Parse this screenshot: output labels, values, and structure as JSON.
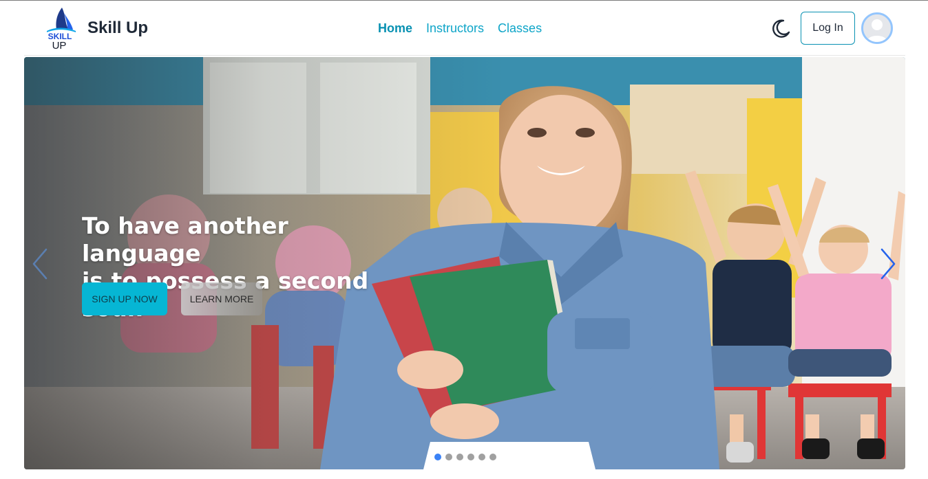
{
  "brand": {
    "logo_text_top": "SKILL",
    "logo_text_bottom": "UP",
    "name": "Skill Up"
  },
  "nav": {
    "links": [
      {
        "label": "Home",
        "active": true
      },
      {
        "label": "Instructors",
        "active": false
      },
      {
        "label": "Classes",
        "active": false
      }
    ],
    "theme_icon": "moon-icon",
    "login_label": "Log In",
    "avatar_icon": "user-avatar-icon"
  },
  "hero": {
    "headline_line1": "To have another language",
    "headline_line2": "is to possess a second soul.",
    "primary_cta": "SIGN UP NOW",
    "secondary_cta": "LEARN MORE",
    "prev_icon": "chevron-left-icon",
    "next_icon": "chevron-right-icon",
    "slide_count": 6,
    "active_slide": 1
  },
  "colors": {
    "accent": "#0891b2",
    "cta": "#06b6d4",
    "arrow": "#3b82f6"
  }
}
